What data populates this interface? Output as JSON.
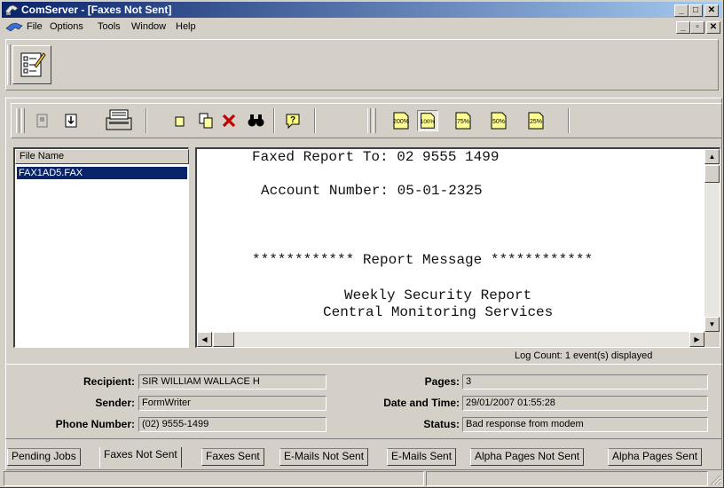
{
  "window": {
    "title": "ComServer - [Faxes Not Sent]"
  },
  "menu": {
    "file": "File",
    "options": "Options",
    "tools": "Tools",
    "window": "Window",
    "help": "Help"
  },
  "toolbar": {
    "zoom_buttons": [
      "200%",
      "100%",
      "75%",
      "50%",
      "25%"
    ]
  },
  "file_list": {
    "header": "File Name",
    "items": [
      "FAX1AD5.FAX"
    ]
  },
  "preview": {
    "lines": [
      "Faxed Report To: 02 9555 1499",
      "Account Number: 05-01-2325",
      "************ Report Message ************",
      "Weekly Security Report",
      "Central Monitoring Services"
    ]
  },
  "log_count": "Log Count:  1 event(s) displayed",
  "details": {
    "recipient_label": "Recipient:",
    "recipient": "SIR WILLIAM WALLACE H",
    "sender_label": "Sender:",
    "sender": "FormWriter",
    "phone_label": "Phone Number:",
    "phone": "(02) 9555-1499",
    "pages_label": "Pages:",
    "pages": "3",
    "datetime_label": "Date and Time:",
    "datetime": "29/01/2007 01:55:28",
    "status_label": "Status:",
    "status": "Bad response from modem"
  },
  "tabs": [
    "Pending Jobs",
    "Faxes Not Sent",
    "Faxes Sent",
    "E-Mails Not Sent",
    "E-Mails Sent",
    "Alpha Pages Not Sent",
    "Alpha Pages Sent"
  ],
  "active_tab": "Faxes Not Sent",
  "colors": {
    "titlebar": "#0a246a",
    "selection": "#0a246a",
    "face": "#d4d0c8"
  }
}
